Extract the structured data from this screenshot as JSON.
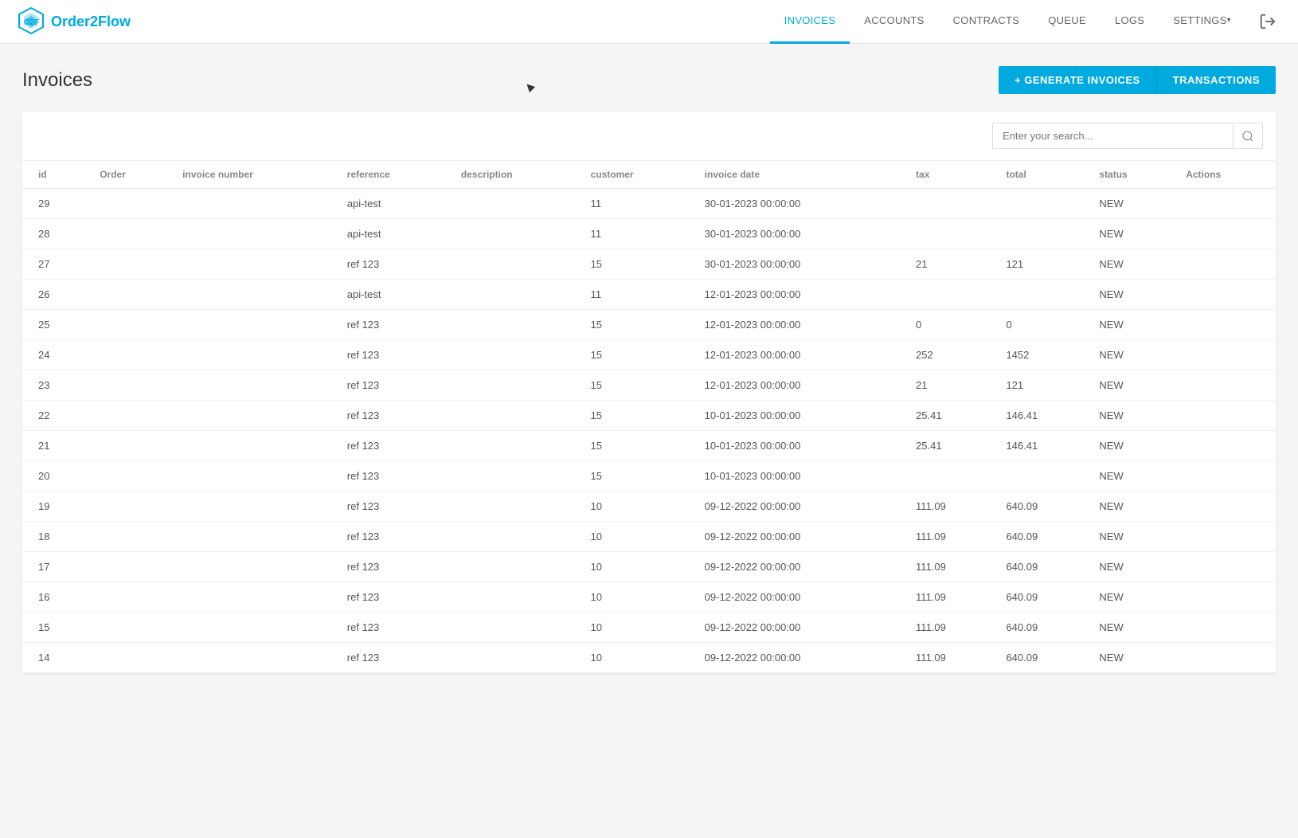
{
  "logo": {
    "text_part1": "Order",
    "text_part2": "2Flow"
  },
  "nav": {
    "links": [
      {
        "id": "invoices",
        "label": "INVOICES",
        "active": true
      },
      {
        "id": "accounts",
        "label": "ACCOUNTS",
        "active": false
      },
      {
        "id": "contracts",
        "label": "CONTRACTS",
        "active": false
      },
      {
        "id": "queue",
        "label": "QUEUE",
        "active": false
      },
      {
        "id": "logs",
        "label": "LOGS",
        "active": false
      },
      {
        "id": "settings",
        "label": "SETTINGS",
        "active": false,
        "hasArrow": true
      }
    ]
  },
  "page": {
    "title": "Invoices"
  },
  "buttons": {
    "generate": "+ GENERATE INVOICES",
    "transactions": "TRANSACTIONS"
  },
  "search": {
    "placeholder": "Enter your search..."
  },
  "table": {
    "columns": [
      {
        "id": "id",
        "label": "id"
      },
      {
        "id": "order",
        "label": "Order"
      },
      {
        "id": "invoice_number",
        "label": "invoice number"
      },
      {
        "id": "reference",
        "label": "reference"
      },
      {
        "id": "description",
        "label": "description"
      },
      {
        "id": "customer",
        "label": "customer"
      },
      {
        "id": "invoice_date",
        "label": "invoice date"
      },
      {
        "id": "tax",
        "label": "tax"
      },
      {
        "id": "total",
        "label": "total"
      },
      {
        "id": "status",
        "label": "status"
      },
      {
        "id": "actions",
        "label": "Actions"
      }
    ],
    "rows": [
      {
        "id": "29",
        "order": "",
        "invoice_number": "",
        "reference": "api-test",
        "description": "",
        "customer": "11",
        "invoice_date": "30-01-2023 00:00:00",
        "tax": "",
        "total": "",
        "status": "NEW"
      },
      {
        "id": "28",
        "order": "",
        "invoice_number": "",
        "reference": "api-test",
        "description": "",
        "customer": "11",
        "invoice_date": "30-01-2023 00:00:00",
        "tax": "",
        "total": "",
        "status": "NEW"
      },
      {
        "id": "27",
        "order": "",
        "invoice_number": "",
        "reference": "ref 123",
        "description": "",
        "customer": "15",
        "invoice_date": "30-01-2023 00:00:00",
        "tax": "21",
        "total": "121",
        "status": "NEW"
      },
      {
        "id": "26",
        "order": "",
        "invoice_number": "",
        "reference": "api-test",
        "description": "",
        "customer": "11",
        "invoice_date": "12-01-2023 00:00:00",
        "tax": "",
        "total": "",
        "status": "NEW"
      },
      {
        "id": "25",
        "order": "",
        "invoice_number": "",
        "reference": "ref 123",
        "description": "",
        "customer": "15",
        "invoice_date": "12-01-2023 00:00:00",
        "tax": "0",
        "total": "0",
        "status": "NEW"
      },
      {
        "id": "24",
        "order": "",
        "invoice_number": "",
        "reference": "ref 123",
        "description": "",
        "customer": "15",
        "invoice_date": "12-01-2023 00:00:00",
        "tax": "252",
        "total": "1452",
        "status": "NEW"
      },
      {
        "id": "23",
        "order": "",
        "invoice_number": "",
        "reference": "ref 123",
        "description": "",
        "customer": "15",
        "invoice_date": "12-01-2023 00:00:00",
        "tax": "21",
        "total": "121",
        "status": "NEW"
      },
      {
        "id": "22",
        "order": "",
        "invoice_number": "",
        "reference": "ref 123",
        "description": "",
        "customer": "15",
        "invoice_date": "10-01-2023 00:00:00",
        "tax": "25.41",
        "total": "146.41",
        "status": "NEW"
      },
      {
        "id": "21",
        "order": "",
        "invoice_number": "",
        "reference": "ref 123",
        "description": "",
        "customer": "15",
        "invoice_date": "10-01-2023 00:00:00",
        "tax": "25.41",
        "total": "146.41",
        "status": "NEW"
      },
      {
        "id": "20",
        "order": "",
        "invoice_number": "",
        "reference": "ref 123",
        "description": "",
        "customer": "15",
        "invoice_date": "10-01-2023 00:00:00",
        "tax": "",
        "total": "",
        "status": "NEW"
      },
      {
        "id": "19",
        "order": "",
        "invoice_number": "",
        "reference": "ref 123",
        "description": "",
        "customer": "10",
        "invoice_date": "09-12-2022 00:00:00",
        "tax": "111.09",
        "total": "640.09",
        "status": "NEW"
      },
      {
        "id": "18",
        "order": "",
        "invoice_number": "",
        "reference": "ref 123",
        "description": "",
        "customer": "10",
        "invoice_date": "09-12-2022 00:00:00",
        "tax": "111.09",
        "total": "640.09",
        "status": "NEW"
      },
      {
        "id": "17",
        "order": "",
        "invoice_number": "",
        "reference": "ref 123",
        "description": "",
        "customer": "10",
        "invoice_date": "09-12-2022 00:00:00",
        "tax": "111.09",
        "total": "640.09",
        "status": "NEW"
      },
      {
        "id": "16",
        "order": "",
        "invoice_number": "",
        "reference": "ref 123",
        "description": "",
        "customer": "10",
        "invoice_date": "09-12-2022 00:00:00",
        "tax": "111.09",
        "total": "640.09",
        "status": "NEW"
      },
      {
        "id": "15",
        "order": "",
        "invoice_number": "",
        "reference": "ref 123",
        "description": "",
        "customer": "10",
        "invoice_date": "09-12-2022 00:00:00",
        "tax": "111.09",
        "total": "640.09",
        "status": "NEW"
      },
      {
        "id": "14",
        "order": "",
        "invoice_number": "",
        "reference": "ref 123",
        "description": "",
        "customer": "10",
        "invoice_date": "09-12-2022 00:00:00",
        "tax": "111.09",
        "total": "640.09",
        "status": "NEW"
      }
    ]
  }
}
